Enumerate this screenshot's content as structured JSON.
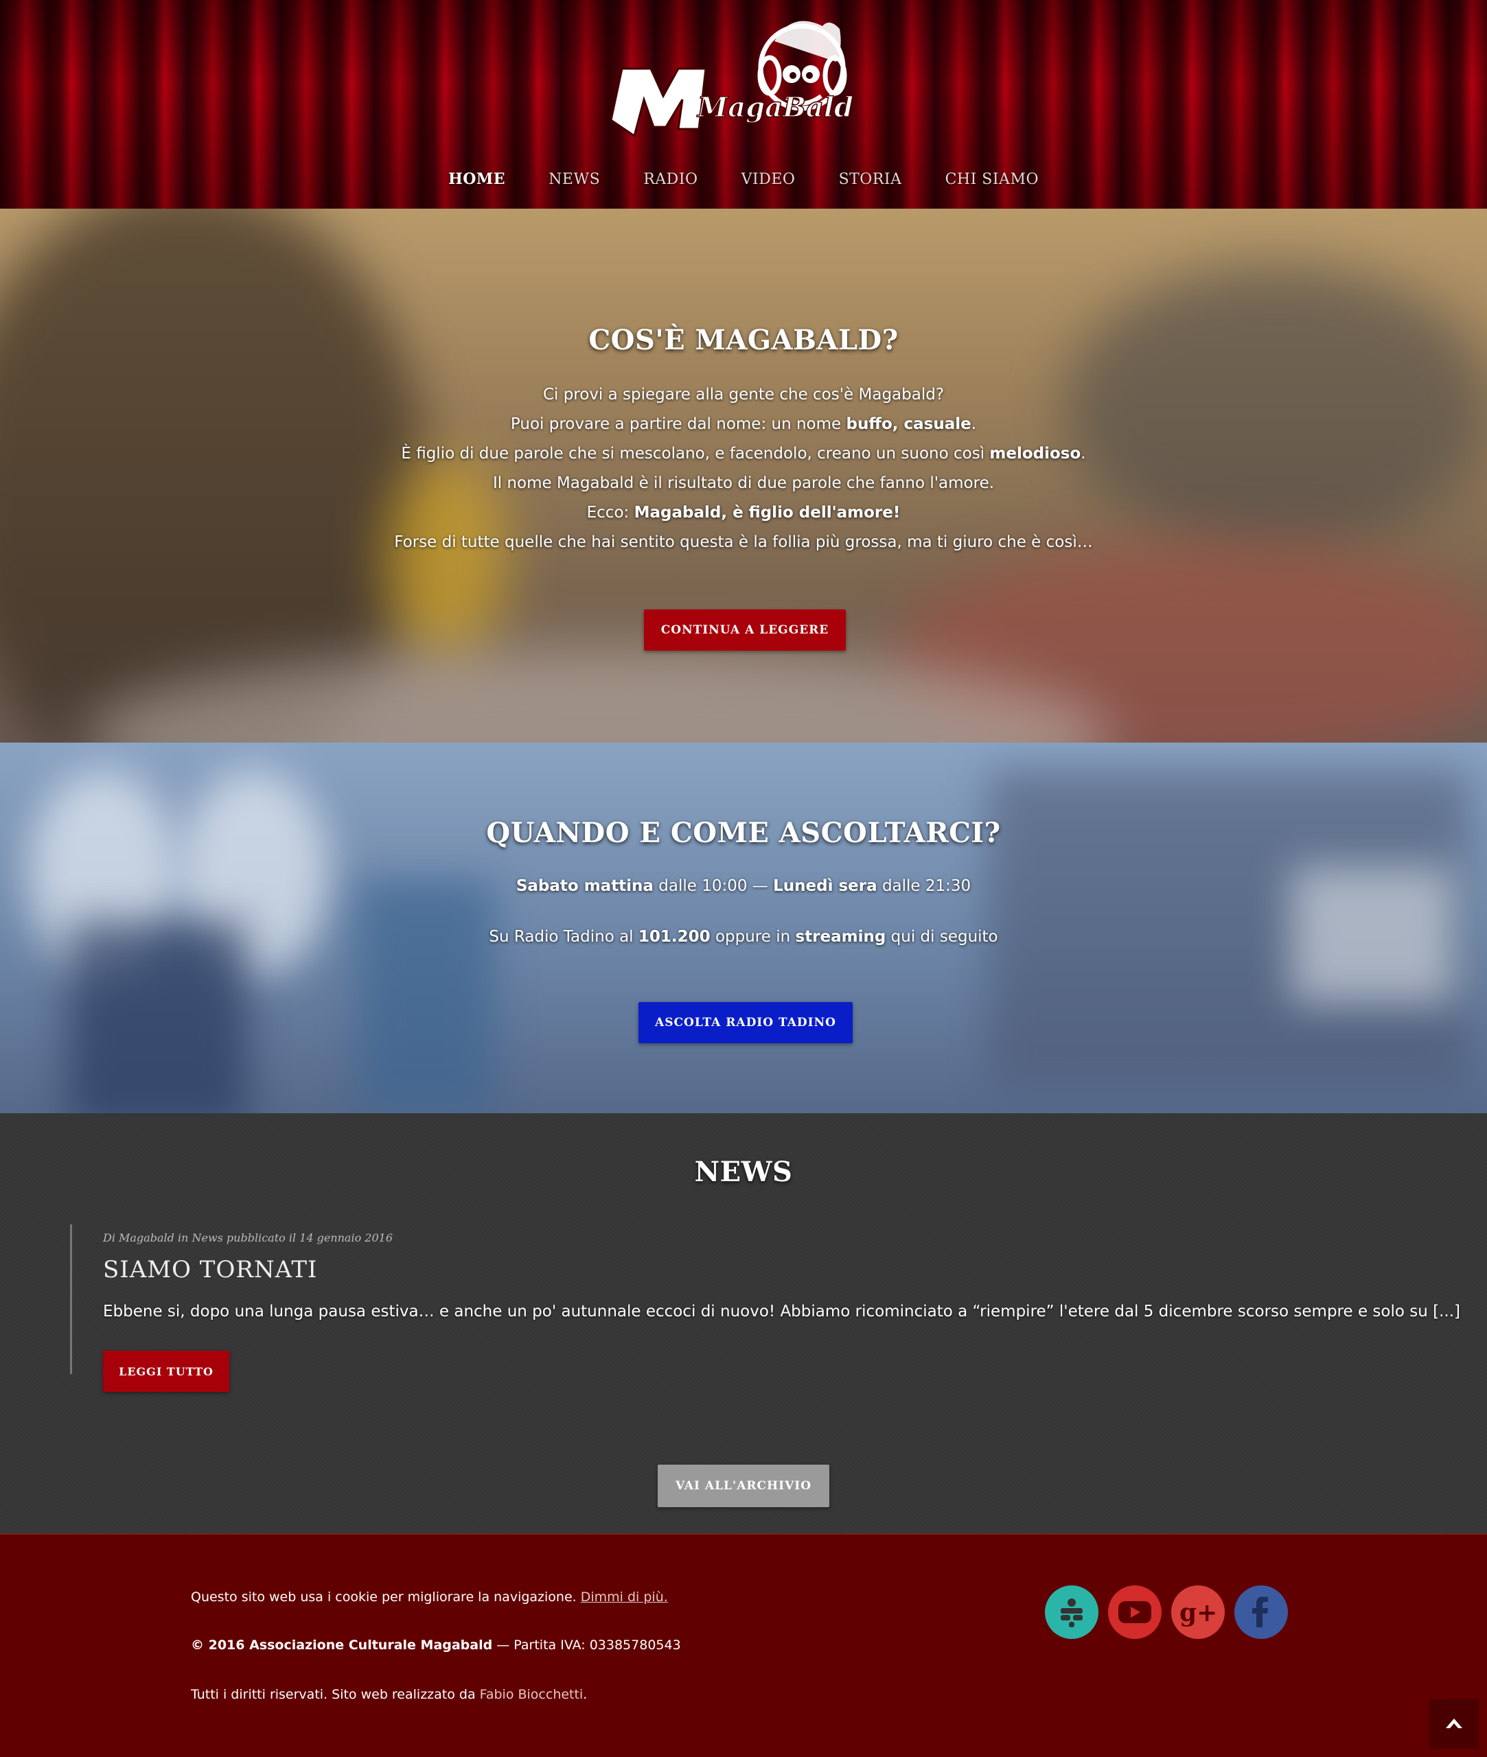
{
  "header": {
    "logo_text": "MagaBald",
    "nav": [
      {
        "label": "HOME",
        "active": true
      },
      {
        "label": "NEWS",
        "active": false
      },
      {
        "label": "RADIO",
        "active": false
      },
      {
        "label": "VIDEO",
        "active": false
      },
      {
        "label": "STORIA",
        "active": false
      },
      {
        "label": "CHI SIAMO",
        "active": false
      }
    ]
  },
  "intro": {
    "title": "COS'È MAGABALD?",
    "lines": [
      [
        "Ci provi a spiegare alla gente che cos'è Magabald?"
      ],
      [
        "Puoi provare a partire dal nome: un nome ",
        "buffo, casuale",
        "."
      ],
      [
        "È figlio di due parole che si mescolano, e facendolo, creano un suono così ",
        "melodioso",
        "."
      ],
      [
        "Il nome Magabald è il risultato di due parole che fanno l'amore."
      ],
      [
        "Ecco: ",
        "Magabald, è figlio dell'amore!",
        ""
      ],
      [
        "Forse di tutte quelle che hai sentito questa è la follia più grossa, ma ti giuro che è così…"
      ]
    ],
    "button": "CONTINUA A LEGGERE",
    "button_color": "#a8000a"
  },
  "listen": {
    "title": "QUANDO E COME ASCOLTARCI?",
    "line1": [
      "Sabato mattina",
      " dalle 10:00 — ",
      "Lunedì sera",
      " dalle 21:30"
    ],
    "line2": [
      "Su Radio Tadino al ",
      "101.200",
      " oppure in ",
      "streaming",
      " qui di seguito"
    ],
    "button": "ASCOLTA RADIO TADINO",
    "button_color": "#0a1ec8"
  },
  "news": {
    "title": "NEWS",
    "items": [
      {
        "meta": "Di Magabald  in News pubblicato il  14 gennaio 2016",
        "title": "SIAMO TORNATI",
        "excerpt": "Ebbene si, dopo una lunga pausa estiva… e anche un po' autunnale eccoci di nuovo! Abbiamo ricominciato a “riempire” l'etere dal 5 dicembre scorso sempre e solo su [...]",
        "button": "LEGGI TUTTO"
      }
    ],
    "archive_button": "VAI ALL'ARCHIVIO"
  },
  "footer": {
    "cookie_text": "Questo sito web usa i cookie per migliorare la navigazione. ",
    "cookie_link": "Dimmi di più.",
    "copyright": "© 2016 Associazione Culturale Magabald",
    "vat": " — Partita IVA: 03385780543",
    "rights": "Tutti i diritti riservati. Sito web realizzato da ",
    "author": "Fabio Biocchetti",
    "rights_end": ".",
    "social": [
      {
        "icon": "tunein-icon",
        "color": "#2bb5a8"
      },
      {
        "icon": "youtube-icon",
        "color": "#d42b2b"
      },
      {
        "icon": "google-plus-icon",
        "color": "#d9403a"
      },
      {
        "icon": "facebook-icon",
        "color": "#3b5aa0"
      }
    ]
  }
}
